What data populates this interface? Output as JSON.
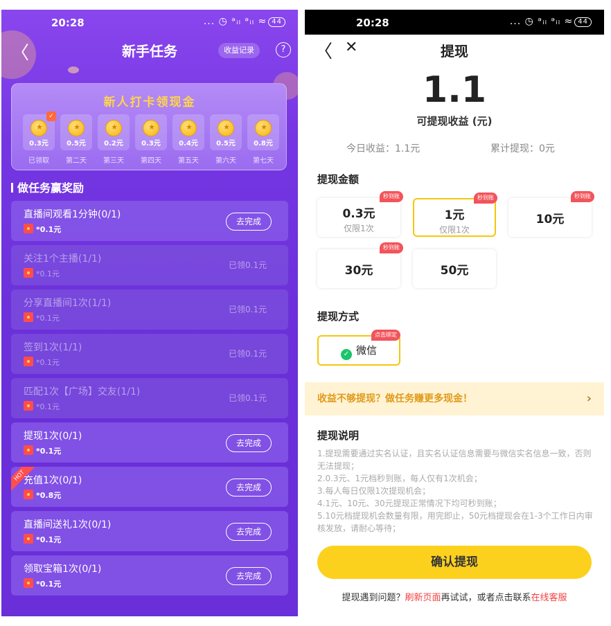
{
  "left": {
    "status": {
      "time": "20:28",
      "icons": "... ◷ ᵊᵢₗ ᵊᵢₗ ≈",
      "battery": "44"
    },
    "header": {
      "back": "〈",
      "title": "新手任务",
      "records": "收益记录",
      "help": "?"
    },
    "checkin": {
      "title": "新人打卡领现金",
      "days": [
        {
          "amount": "0.3元",
          "label": "已领取",
          "claimed": true
        },
        {
          "amount": "0.5元",
          "label": "第二天",
          "claimed": false
        },
        {
          "amount": "0.2元",
          "label": "第三天",
          "claimed": false
        },
        {
          "amount": "0.3元",
          "label": "第四天",
          "claimed": false
        },
        {
          "amount": "0.4元",
          "label": "第五天",
          "claimed": false
        },
        {
          "amount": "0.5元",
          "label": "第六天",
          "claimed": false
        },
        {
          "amount": "0.8元",
          "label": "第七天",
          "claimed": false
        }
      ]
    },
    "section_title": "做任务赢奖励",
    "tasks": [
      {
        "name": "直播间观看1分钟(0/1)",
        "reward": "*0.1元",
        "action": "去完成",
        "done": false,
        "hot": false
      },
      {
        "name": "关注1个主播(1/1)",
        "reward": "*0.1元",
        "action": "已领0.1元",
        "done": true,
        "hot": false
      },
      {
        "name": "分享直播间1次(1/1)",
        "reward": "*0.1元",
        "action": "已领0.1元",
        "done": true,
        "hot": false
      },
      {
        "name": "签到1次(1/1)",
        "reward": "*0.1元",
        "action": "已领0.1元",
        "done": true,
        "hot": false
      },
      {
        "name": "匹配1次【广场】交友(1/1)",
        "reward": "*0.1元",
        "action": "已领0.1元",
        "done": true,
        "hot": false
      },
      {
        "name": "提现1次(0/1)",
        "reward": "*0.1元",
        "action": "去完成",
        "done": false,
        "hot": false
      },
      {
        "name": "充值1次(0/1)",
        "reward": "*0.8元",
        "action": "去完成",
        "done": false,
        "hot": true
      },
      {
        "name": "直播间送礼1次(0/1)",
        "reward": "*0.1元",
        "action": "去完成",
        "done": false,
        "hot": false
      },
      {
        "name": "领取宝箱1次(0/1)",
        "reward": "*0.1元",
        "action": "去完成",
        "done": false,
        "hot": false
      }
    ],
    "hot_label": "HOT"
  },
  "right": {
    "status": {
      "time": "20:28",
      "icons": "... ◷ ᵊᵢₗ ᵊᵢₗ ≈",
      "battery": "44"
    },
    "header": {
      "back": "〈",
      "close": "✕",
      "title": "提现"
    },
    "balance": "1.1",
    "balance_label": "可提现收益 (元)",
    "today": "今日收益：1.1元",
    "total": "累计提现：0元",
    "amount_title": "提现金额",
    "amounts": [
      {
        "value": "0.3元",
        "sub": "仅限1次",
        "tag": "秒到账",
        "selected": false
      },
      {
        "value": "1元",
        "sub": "仅限1次",
        "tag": "秒到账",
        "selected": true
      },
      {
        "value": "10元",
        "sub": "",
        "tag": "秒到账",
        "selected": false
      },
      {
        "value": "30元",
        "sub": "",
        "tag": "秒到账",
        "selected": false
      },
      {
        "value": "50元",
        "sub": "",
        "tag": "",
        "selected": false
      }
    ],
    "method_title": "提现方式",
    "method": {
      "label": "微信",
      "tag": "点击绑定"
    },
    "banner": {
      "text": "收益不够提现？做任务赚更多现金！",
      "arrow": "›"
    },
    "notes_title": "提现说明",
    "notes": [
      "1.提现需要通过实名认证，且实名认证信息需要与微信实名信息一致，否则无法提现；",
      "2.0.3元、1元档秒到账，每人仅有1次机会；",
      "3.每人每日仅限1次提现机会；",
      "4.1元、10元、30元提现正常情况下均可秒到账；",
      "5.10元档提现机会数量有限，用完即止，50元档提现会在1-3个工作日内审核发放，请耐心等待；"
    ],
    "confirm": "确认提现",
    "help": {
      "prefix": "提现遇到问题？",
      "refresh": "刷新页面",
      "middle": "再试试，或者点击联系",
      "service": "在线客服"
    },
    "colors": {
      "accent": "#fcd11e",
      "link": "#f24040",
      "banner_text": "#e09a1a"
    }
  }
}
